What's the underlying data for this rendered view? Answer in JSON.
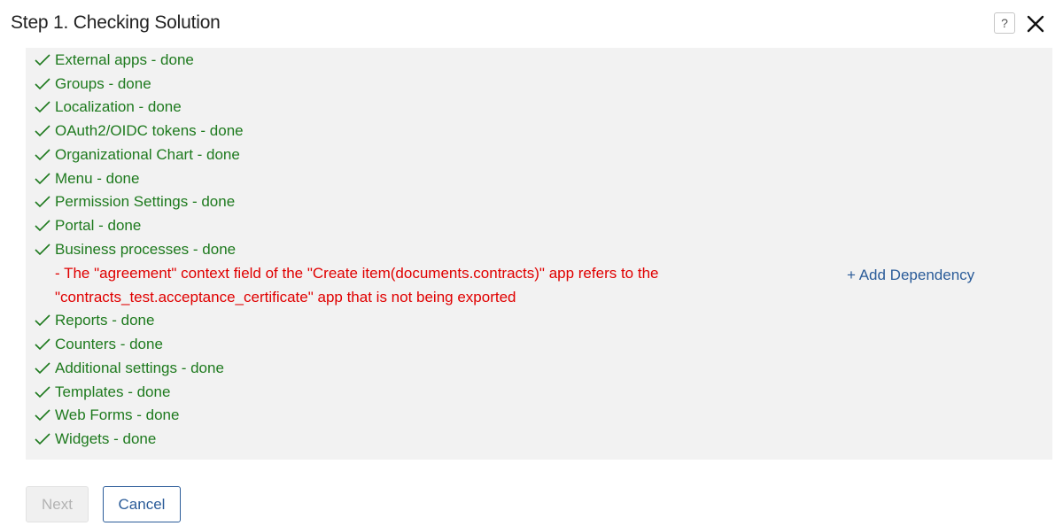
{
  "header": {
    "title": "Step 1. Checking Solution",
    "help_label": "?"
  },
  "checks": [
    {
      "label": "External apps - done"
    },
    {
      "label": "Groups - done"
    },
    {
      "label": "Localization - done"
    },
    {
      "label": "OAuth2/OIDC tokens - done"
    },
    {
      "label": "Organizational Chart - done"
    },
    {
      "label": "Menu - done"
    },
    {
      "label": "Permission Settings - done"
    },
    {
      "label": "Portal - done"
    },
    {
      "label": "Business processes - done"
    },
    {
      "label": "Reports - done"
    },
    {
      "label": "Counters - done"
    },
    {
      "label": "Additional settings - done"
    },
    {
      "label": "Templates - done"
    },
    {
      "label": "Web Forms - done"
    },
    {
      "label": "Widgets - done"
    }
  ],
  "error": {
    "line1": "- The \"agreement\" context field of the \"Create item(documents.contracts)\" app refers to the",
    "line2": "\"contracts_test.acceptance_certificate\" app that is not being exported",
    "action_label": "+ Add Dependency"
  },
  "footer": {
    "next_label": "Next",
    "cancel_label": "Cancel"
  },
  "colors": {
    "success": "#1e7a1e",
    "error": "#e00000",
    "link": "#2b5c99",
    "panel_bg": "#f2f2f2"
  }
}
